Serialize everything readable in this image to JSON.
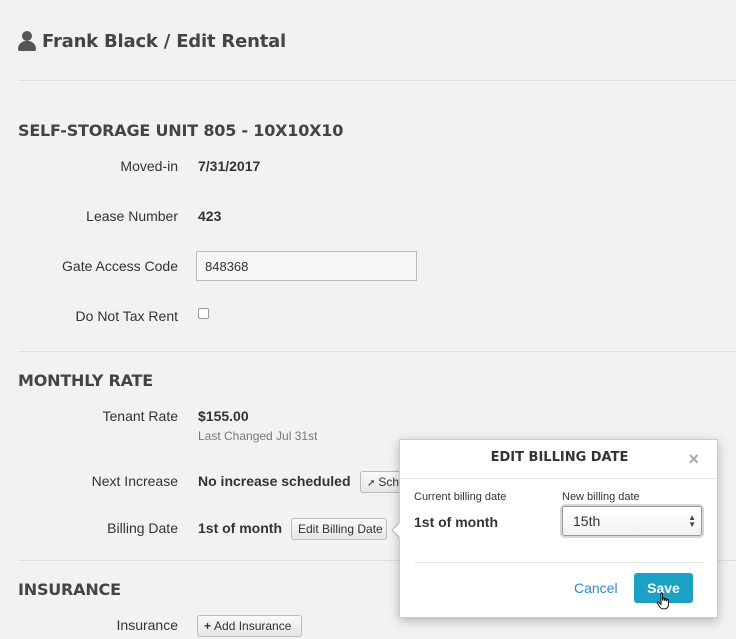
{
  "header": {
    "title": "Frank Black / Edit Rental",
    "icon": "user-icon"
  },
  "unit": {
    "title": "SELF-STORAGE UNIT 805 - 10X10X10",
    "moved_in_label": "Moved-in",
    "moved_in_value": "7/31/2017",
    "lease_label": "Lease Number",
    "lease_value": "423",
    "gate_label": "Gate Access Code",
    "gate_value": "848368",
    "tax_label": "Do Not Tax Rent",
    "tax_checked": false
  },
  "rate": {
    "title": "MONTHLY RATE",
    "tenant_label": "Tenant Rate",
    "tenant_value": "$155.00",
    "tenant_sub": "Last Changed Jul 31st",
    "increase_label": "Next Increase",
    "increase_value": "No increase scheduled",
    "schedule_button": "Sch",
    "billing_label": "Billing Date",
    "billing_value": "1st of month",
    "edit_billing_button": "Edit Billing Date"
  },
  "insurance": {
    "title": "INSURANCE",
    "label": "Insurance",
    "add_button": "Add Insurance"
  },
  "popover": {
    "title": "EDIT BILLING DATE",
    "close": "×",
    "current_label": "Current billing date",
    "current_value": "1st of month",
    "new_label": "New billing date",
    "new_value": "15th",
    "cancel": "Cancel",
    "save": "Save"
  },
  "colors": {
    "accent": "#1ba1c4",
    "link": "#2a8fc6",
    "background": "#f2f2f2"
  }
}
